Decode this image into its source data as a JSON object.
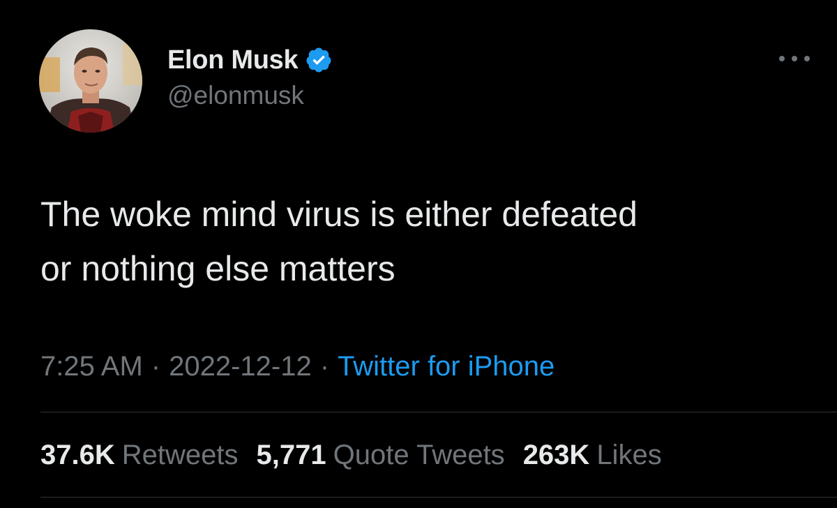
{
  "user": {
    "display_name": "Elon Musk",
    "handle": "@elonmusk",
    "verified": true,
    "avatar": "profile-photo"
  },
  "tweet": {
    "text": "The woke mind virus is either defeated\nor nothing else matters",
    "time": "7:25 AM",
    "separator": "·",
    "date": "2022-12-12",
    "source": "Twitter for iPhone"
  },
  "stats": {
    "retweets_count": "37.6K",
    "retweets_label": "Retweets",
    "quotes_count": "5,771",
    "quotes_label": "Quote Tweets",
    "likes_count": "263K",
    "likes_label": "Likes"
  },
  "icons": {
    "verified": "verified-badge-icon",
    "more": "more-options-icon"
  },
  "colors": {
    "background": "#000000",
    "primary_text": "#e7e9ea",
    "secondary_text": "#71767b",
    "accent": "#1d9bf0",
    "divider": "#2f3336"
  }
}
